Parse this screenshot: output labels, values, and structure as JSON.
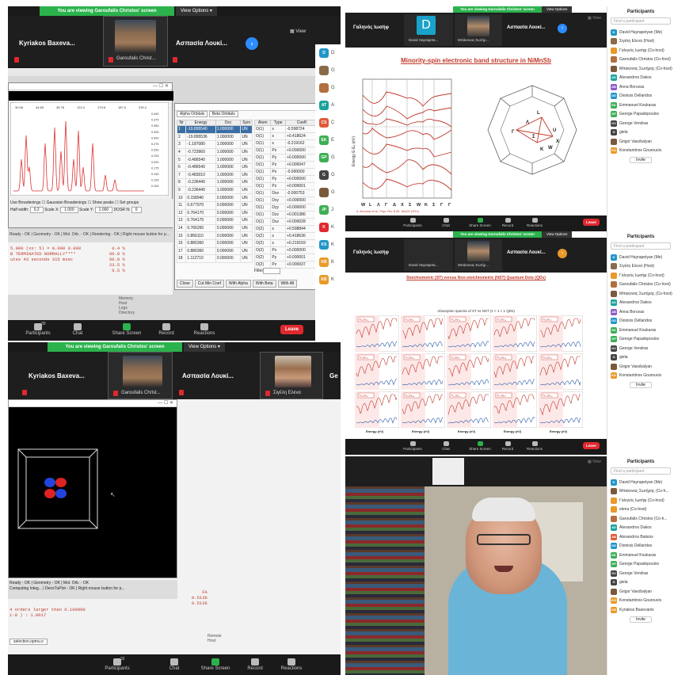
{
  "banner": "You are viewing Garoufalis Christos' screen",
  "view_options": "View Options",
  "view": "View",
  "names": {
    "kyriakos": "Kyriakos Baxeva...",
    "garoufalis": "Garoufalis Christ...",
    "aspasia": "Aσπασία Λουκί...",
    "galeni": "Γαληνός Ιωσήφ",
    "zigeli": "Σιγέλη Ελενα",
    "david_short": "David Hayrapeta...",
    "mimis_short": "Μπάκονας Σωτήρ...",
    "aspasia2": "Aσπασία Λουκί...",
    "d_letter": "D",
    "ge": "Ge"
  },
  "toolbar": {
    "participants": "Participants",
    "participants_count": "30",
    "participants_count_b": "32",
    "chat": "Chat",
    "share": "Share Screen",
    "record": "Record",
    "reactions": "Reactions",
    "leave": "Leave"
  },
  "q1": {
    "tabs": [
      "Alpha Orbitals",
      "Beta Orbitals"
    ],
    "col_headers": [
      "Nr",
      "Energy",
      "Occ",
      "Sym"
    ],
    "rows": [
      [
        "1",
        "-19.895540",
        "1.000000",
        "UN"
      ],
      [
        "2",
        "-19.895536",
        "1.000000",
        "UN"
      ],
      [
        "3",
        "-1.187080",
        "1.000000",
        "UN"
      ],
      [
        "4",
        "-0.723960",
        "1.000000",
        "UN"
      ],
      [
        "5",
        "-0.486540",
        "1.000000",
        "UN"
      ],
      [
        "6",
        "-0.486540",
        "1.000000",
        "UN"
      ],
      [
        "7",
        "-0.483010",
        "1.000000",
        "UN"
      ],
      [
        "8",
        "-0.236440",
        "1.000000",
        "UN"
      ],
      [
        "9",
        "-0.236440",
        "1.000000",
        "UN"
      ],
      [
        "10",
        "0.158940",
        "0.000000",
        "UN"
      ],
      [
        "11",
        "0.677970",
        "0.000000",
        "UN"
      ],
      [
        "12",
        "0.764170",
        "0.000000",
        "UN"
      ],
      [
        "13",
        "0.764170",
        "0.000000",
        "UN"
      ],
      [
        "14",
        "0.766260",
        "0.000000",
        "UN"
      ],
      [
        "15",
        "0.856110",
        "0.000000",
        "UN"
      ],
      [
        "16",
        "0.880360",
        "0.000000",
        "UN"
      ],
      [
        "17",
        "0.880360",
        "0.000000",
        "UN"
      ],
      [
        "18",
        "1.112710",
        "0.000000",
        "UN"
      ]
    ],
    "atom_headers": [
      "Atom",
      "Type",
      "Coeff."
    ],
    "atom_rows": [
      [
        "O(1)",
        "s",
        "-0.598724"
      ],
      [
        "O(1)",
        "s",
        "+0.418624"
      ],
      [
        "O(1)",
        "s",
        "-0.219162"
      ],
      [
        "O(1)",
        "Px",
        "+0.000000"
      ],
      [
        "O(1)",
        "Py",
        "+0.000000"
      ],
      [
        "O(1)",
        "Pz",
        "+0.000047"
      ],
      [
        "O(1)",
        "Px",
        "-0.000000"
      ],
      [
        "O(1)",
        "Py",
        "+0.000000"
      ],
      [
        "O(1)",
        "Pz",
        "+0.000001"
      ],
      [
        "O(1)",
        "Dxx",
        "-0.000753"
      ],
      [
        "O(1)",
        "Dxy",
        "+0.000000"
      ],
      [
        "O(1)",
        "Dyy",
        "+0.000000"
      ],
      [
        "O(1)",
        "Dzz",
        "+0.001386"
      ],
      [
        "O(1)",
        "Dxz",
        "+0.000028"
      ],
      [
        "O(2)",
        "s",
        "+0.598844"
      ],
      [
        "O(2)",
        "s",
        "+0.418636"
      ],
      [
        "O(2)",
        "s",
        "+0.219159"
      ],
      [
        "O(2)",
        "Px",
        "+0.000000"
      ],
      [
        "O(2)",
        "Py",
        "+0.000001"
      ],
      [
        "O(2)",
        "Pz",
        "+0.000037"
      ]
    ],
    "filter_label": "Filter",
    "buttons": [
      "Close",
      "Cut Min Coef",
      "With Alpha",
      "With Beta",
      "With All"
    ],
    "options": [
      "Use Broadenings",
      "Gaussian Broadenings",
      "Show peaks",
      "Set groups"
    ],
    "halfwidth": "Half width:",
    "halfwidth_val": "0.2",
    "scale_x": "Scale X:",
    "scale_y": "Scale Y:",
    "one": "1.000",
    "dosr": "DOSR N:",
    "dosr_val": "0",
    "console": [
      "5.000 (xx: 5) = 0.000 0.000",
      "B TERMINATED NORMALLY****",
      "utes 43 seconds 315 msec"
    ],
    "pct": [
      "0.4 %",
      "60.0 %",
      "60.0 %",
      "23.5 %",
      "0.5 %"
    ],
    "status": [
      "Ready - OK",
      "Geometry - OK",
      "Mol. Orb. - OK",
      "Rendering - OK",
      "Right mouse button for p..."
    ],
    "side_tags": [
      "Memory",
      "Host",
      "Logs",
      "Directory"
    ],
    "x_ticks": [
      "30.08",
      "44.65",
      "45.78",
      "122.4",
      "179.8",
      "187.0",
      "230.2"
    ],
    "y_ticks": [
      "0.400",
      "0.375",
      "0.350",
      "0.325",
      "0.300",
      "0.275",
      "0.250",
      "0.225",
      "0.200",
      "0.175",
      "0.150",
      "0.125",
      "0.100"
    ]
  },
  "midlist": [
    {
      "t": "D",
      "c": "#2196c8",
      "n": "D"
    },
    {
      "t": "",
      "c": "#8a6a4a",
      "n": "G"
    },
    {
      "t": "",
      "c": "#b07040",
      "n": "G"
    },
    {
      "t": "AT",
      "c": "#1aa39a",
      "n": "A"
    },
    {
      "t": "CS",
      "c": "#e05a3a",
      "n": "C"
    },
    {
      "t": "EK",
      "c": "#3dae55",
      "n": "E"
    },
    {
      "t": "GP",
      "c": "#3dae55",
      "n": "G"
    },
    {
      "t": "G",
      "c": "#444",
      "n": "G"
    },
    {
      "t": "",
      "c": "#7a5a3a",
      "n": "G"
    },
    {
      "t": "JP",
      "c": "#3dae55",
      "n": "J"
    },
    {
      "t": "K",
      "c": "#e0282e",
      "n": "K"
    },
    {
      "t": "KS",
      "c": "#2196c8",
      "n": "K"
    },
    {
      "t": "KB",
      "c": "#e89a2a",
      "n": "K"
    },
    {
      "t": "KB",
      "c": "#e89a2a",
      "n": "K"
    }
  ],
  "q2": {
    "title": "Minority-spin electronic band structure in NiMnSb",
    "kpath": [
      "W",
      "L",
      "Λ",
      "Γ",
      "Δ",
      "X",
      "Σ",
      "W",
      "K",
      "Σ",
      "Γ",
      "Γ"
    ],
    "ylabel": "Energy E-Eₓ (eV)",
    "bz_labels": [
      "L",
      "Λ",
      "U",
      "X",
      "K",
      "W",
      "Γ",
      "Σ"
    ],
    "footer": "A. Amoudas et al., Phys. Rev. B 85, 184422 (2012)"
  },
  "q4": {
    "title": "Stoichiometric (ST) versus Non-stoichiometric (NST) Quantum Dots (QDs)",
    "subtitle": "Absorption spectra of ST vs NST (1 < 1 < 1 QDs)",
    "xlab": "Energy (eV)",
    "panel_labels": [
      "Ti₁₆Se₁₆",
      "Ti₁₆Se₁₇",
      "Ti₁₆Se₁₈",
      "Ti₁₇Se₁₆",
      "Ti₁₇Se₁₇",
      "Ti₁₇Se₁₈",
      "Ti₁₈Se₁₆",
      "Ti₁₈Se₁₇",
      "Ti₁₈Se₁₈",
      "Ti₁₉Se₁₆",
      "Ti₁₉Se₁₇",
      "Ti₁₉Se₁₈",
      "Ti₂₀Se₁₆",
      "Ti₂₀Se₁₇",
      "Ti₂₀Se₁₈"
    ]
  },
  "q3": {
    "status": [
      "Ready - OK",
      "Geometry - OK",
      "Mol. Orb. - OK",
      "Computing Integ...",
      "DensTuPlot - OK",
      "Right mouse button for p..."
    ],
    "console": [
      "4 orders larger than 0.100000",
      "1-0 ) :      1.0017"
    ],
    "nums": [
      "FA",
      "0.5136",
      "0.5136"
    ],
    "tab": "selection.opmu.o",
    "side_tags": [
      "Remote",
      "Host"
    ]
  },
  "sidebar": {
    "title": "Participants",
    "find": "Find a participant",
    "invite": "Invite",
    "list_a": [
      {
        "n": "David Hayrapetyan (Me)",
        "t": "D",
        "c": "#2196c8"
      },
      {
        "n": "Σιγέλη Ελενα (Host)",
        "t": "",
        "c": "#8a6a4a"
      },
      {
        "n": "Γαληνός Ιωσήφ (Co-host)",
        "t": "",
        "c": "#e89a2a"
      },
      {
        "n": "Garoufalis Christos (Co-host)",
        "t": "",
        "c": "#b07040"
      },
      {
        "n": "Μπακονας Σωτήρης (Co-host)",
        "t": "",
        "c": "#7a5a3a"
      },
      {
        "n": "Alexandros Dakos",
        "t": "AD",
        "c": "#1aa39a"
      },
      {
        "n": "Anna Boruvas",
        "t": "AB",
        "c": "#8e5ac8"
      },
      {
        "n": "Dionisis Dellaridos",
        "t": "DD",
        "c": "#2196c8"
      },
      {
        "n": "Emmanuel Koukaras",
        "t": "EK",
        "c": "#3dae55"
      },
      {
        "n": "George Papadopoulos",
        "t": "GP",
        "c": "#3dae55"
      },
      {
        "n": "George Vendras",
        "t": "GV",
        "c": "#444"
      },
      {
        "n": "giela",
        "t": "G",
        "c": "#444"
      },
      {
        "n": "Grigor Vaezbalyan",
        "t": "",
        "c": "#7a5a3a"
      },
      {
        "n": "Konstantinos Gourouvis",
        "t": "KG",
        "c": "#e89a2a"
      }
    ],
    "list_c": [
      {
        "n": "David Hayrapetyan (Me)",
        "t": "D",
        "c": "#2196c8"
      },
      {
        "n": "Μπακονας Σωτήρης (Co-h...",
        "t": "",
        "c": "#7a5a3a"
      },
      {
        "n": "Γαληνός Ιωσήφ (Co-host)",
        "t": "",
        "c": "#e89a2a"
      },
      {
        "n": "elena (Co-host)",
        "t": "",
        "c": "#e89a2a"
      },
      {
        "n": "Garoufalis Christos (Co-h...",
        "t": "",
        "c": "#b07040"
      },
      {
        "n": "Alexandros Dakos",
        "t": "AD",
        "c": "#1aa39a"
      },
      {
        "n": "Alexandros Batsios",
        "t": "AB",
        "c": "#e05a3a"
      },
      {
        "n": "Dionisis Dellaridos",
        "t": "DD",
        "c": "#2196c8"
      },
      {
        "n": "Emmanuel Koukaras",
        "t": "EK",
        "c": "#3dae55"
      },
      {
        "n": "George Papadopoulos",
        "t": "GP",
        "c": "#3dae55"
      },
      {
        "n": "George Vendras",
        "t": "GV",
        "c": "#444"
      },
      {
        "n": "giela",
        "t": "G",
        "c": "#444"
      },
      {
        "n": "Grigor Vaezbalyan",
        "t": "",
        "c": "#7a5a3a"
      },
      {
        "n": "Konstantinos Gourouvis",
        "t": "KG",
        "c": "#e89a2a"
      },
      {
        "n": "Kyriakos Baxevanis",
        "t": "KB",
        "c": "#e89a2a"
      }
    ]
  },
  "colors": {
    "zoom_green": "#2bb24c",
    "leave_red": "#e0282e",
    "plot_red": "#c0392b",
    "accent_blue": "#2d8cff"
  }
}
